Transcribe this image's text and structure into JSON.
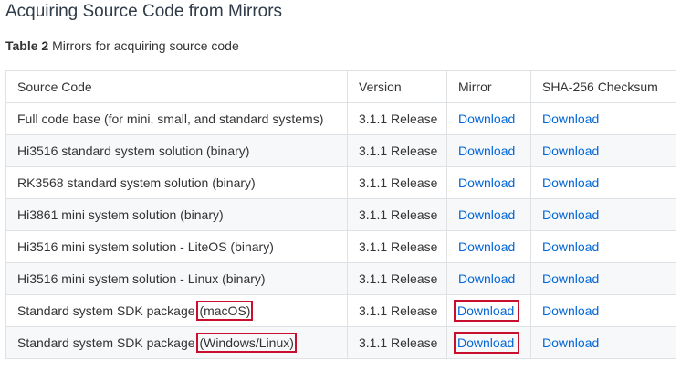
{
  "page": {
    "title": "Acquiring Source Code from Mirrors",
    "caption_label": "Table 2",
    "caption_text": "Mirrors for acquiring source code"
  },
  "table": {
    "headers": [
      "Source Code",
      "Version",
      "Mirror",
      "SHA-256 Checksum"
    ],
    "rows": [
      {
        "source": "Full code base (for mini, small, and standard systems)",
        "source_suffix": "",
        "version": "3.1.1 Release",
        "mirror": "Download",
        "checksum": "Download"
      },
      {
        "source": "Hi3516 standard system solution (binary)",
        "source_suffix": "",
        "version": "3.1.1 Release",
        "mirror": "Download",
        "checksum": "Download"
      },
      {
        "source": "RK3568 standard system solution (binary)",
        "source_suffix": "",
        "version": "3.1.1 Release",
        "mirror": "Download",
        "checksum": "Download"
      },
      {
        "source": "Hi3861 mini system solution (binary)",
        "source_suffix": "",
        "version": "3.1.1 Release",
        "mirror": "Download",
        "checksum": "Download"
      },
      {
        "source": "Hi3516 mini system solution - LiteOS (binary)",
        "source_suffix": "",
        "version": "3.1.1 Release",
        "mirror": "Download",
        "checksum": "Download"
      },
      {
        "source": "Hi3516 mini system solution - Linux (binary)",
        "source_suffix": "",
        "version": "3.1.1 Release",
        "mirror": "Download",
        "checksum": "Download"
      },
      {
        "source": "Standard system SDK package ",
        "source_suffix": "(macOS)",
        "version": "3.1.1 Release",
        "mirror": "Download",
        "checksum": "Download"
      },
      {
        "source": "Standard system SDK package ",
        "source_suffix": "(Windows/Linux)",
        "version": "3.1.1 Release",
        "mirror": "Download",
        "checksum": "Download"
      }
    ]
  },
  "colors": {
    "link": "#0366d6",
    "highlight": "#c8102e",
    "stripe": "#f6f8fa",
    "border": "#dfe2e5"
  }
}
